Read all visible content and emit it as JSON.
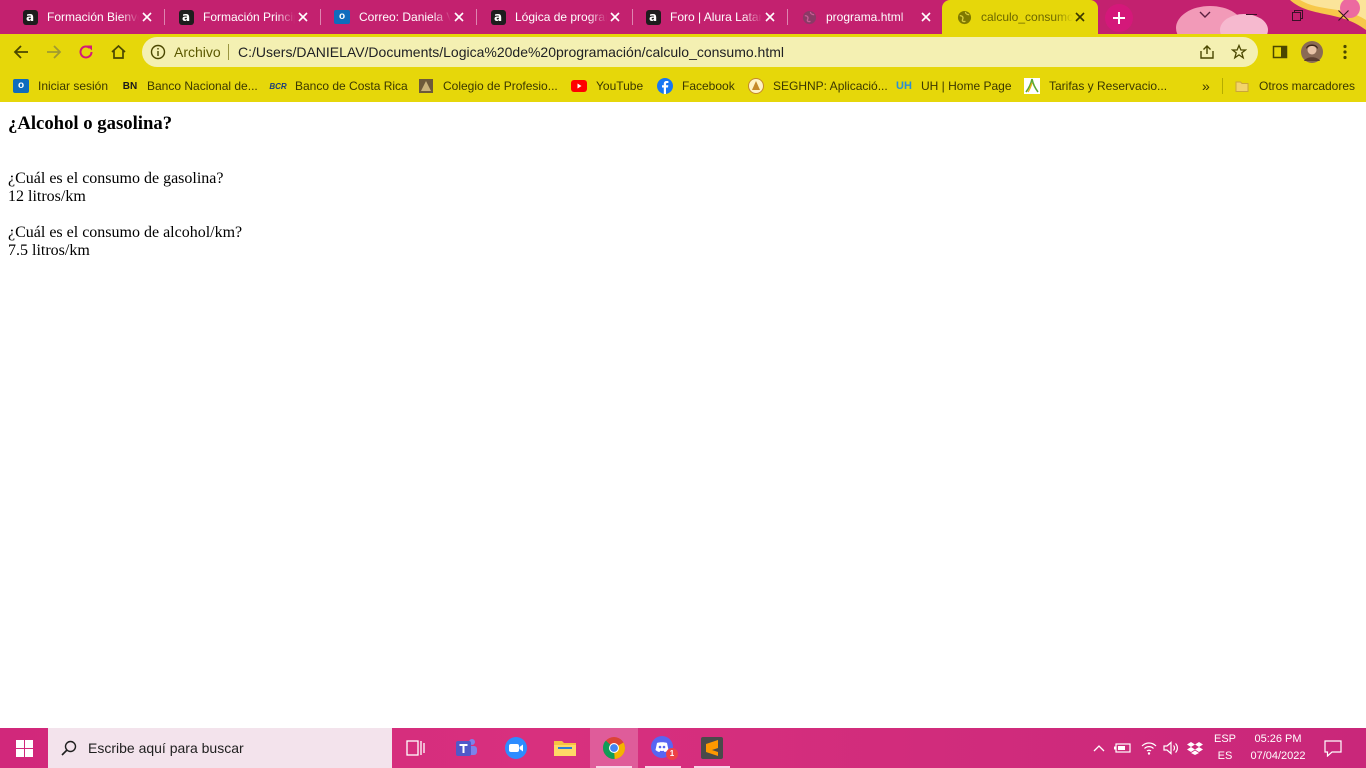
{
  "browser": {
    "tabs": [
      {
        "title": "Formación Bienvenida",
        "favicon": "alura-icon"
      },
      {
        "title": "Formación Principiante",
        "favicon": "alura-icon"
      },
      {
        "title": "Correo: Daniela Valverde",
        "favicon": "outlook-icon"
      },
      {
        "title": "Lógica de programación",
        "favicon": "alura-icon"
      },
      {
        "title": "Foro | Alura Latam",
        "favicon": "alura-icon"
      },
      {
        "title": "programa.html",
        "favicon": "globe-icon"
      },
      {
        "title": "calculo_consumo.html",
        "favicon": "globe-icon",
        "active": true
      }
    ],
    "address": {
      "chip": "Archivo",
      "url": "C:/Users/DANIELAV/Documents/Logica%20de%20programación/calculo_consumo.html"
    },
    "bookmarks": [
      {
        "label": "Iniciar sesión",
        "icon": "outlook-icon"
      },
      {
        "label": "Banco Nacional de...",
        "icon": "bn-icon"
      },
      {
        "label": "Banco de Costa Rica",
        "icon": "bcr-icon"
      },
      {
        "label": "Colegio de Profesio...",
        "icon": "colegio-icon"
      },
      {
        "label": "YouTube",
        "icon": "youtube-icon"
      },
      {
        "label": "Facebook",
        "icon": "facebook-icon"
      },
      {
        "label": "SEGHNP: Aplicació...",
        "icon": "seghnp-icon"
      },
      {
        "label": "UH | Home Page",
        "icon": "uh-icon"
      },
      {
        "label": "Tarifas y Reservacio...",
        "icon": "tarifas-icon"
      }
    ],
    "bookmarks_overflow": "»",
    "other_bookmarks": "Otros marcadores"
  },
  "page": {
    "heading": "¿Alcohol o gasolina?",
    "lines": [
      "¿Cuál es el consumo de gasolina?",
      "12 litros/km",
      "¿Cuál es el consumo de alcohol/km?",
      "7.5 litros/km"
    ]
  },
  "taskbar": {
    "search_placeholder": "Escribe aquí para buscar",
    "language": "ESP",
    "language_sub": "ES",
    "time": "05:26 PM",
    "date": "07/04/2022",
    "discord_badge": "1"
  },
  "colors": {
    "tab_strip": "#c3216f",
    "toolbar": "#e6d70a",
    "omnibox": "#f4f0b2",
    "taskbar": "#d1287b"
  }
}
